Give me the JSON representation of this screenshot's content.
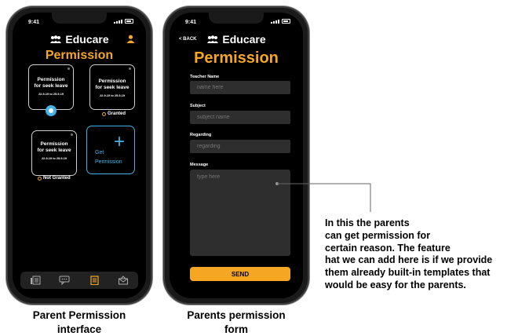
{
  "phone1": {
    "time": "9:41",
    "brand": "Educare",
    "title": "Permission",
    "cards": [
      {
        "line1": "Permission",
        "line2": "for seek leave",
        "dates": "22-9-19 to 25-9-19"
      },
      {
        "line1": "Permission",
        "line2": "for seek leave",
        "dates": "22-9-19 to 25-9-19",
        "status": "Granted"
      },
      {
        "line1": "Permission",
        "line2": "for seek leave",
        "dates": "22-9-19 to 25-9-19",
        "status": "Not Granted"
      }
    ],
    "get_card": {
      "line1": "Get",
      "line2": "Permission",
      "icon": "+"
    },
    "nav_icons": [
      "document-icon",
      "chat-icon",
      "clipboard-icon",
      "mail-icon"
    ],
    "colors": {
      "accent": "#f5a623",
      "blue": "#43b2e6",
      "bg": "#000000"
    }
  },
  "phone2": {
    "time": "9:41",
    "back": "< BACK",
    "brand": "Educare",
    "title": "Permission",
    "fields": {
      "teacher": {
        "label": "Teacher Name",
        "placeholder": "name here"
      },
      "subject": {
        "label": "Subject",
        "placeholder": "subject name"
      },
      "regarding": {
        "label": "Regarding",
        "placeholder": "regarding"
      },
      "message": {
        "label": "Message",
        "placeholder": "type here"
      }
    },
    "send_label": "SEND"
  },
  "captions": {
    "phone1": "Parent Permission\ninterface",
    "phone2": "Parents permission\nform"
  },
  "annotation": "In this the parents\ncan get permission for\ncertain reason. The feature\nhat we can add here is if we provide\nthem already built-in templates that\nwould be easy for the parents."
}
